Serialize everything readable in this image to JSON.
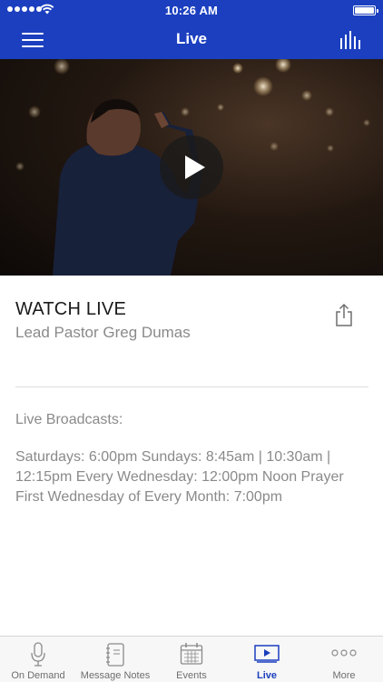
{
  "status_bar": {
    "time": "10:26 AM"
  },
  "nav": {
    "title": "Live"
  },
  "content": {
    "title": "WATCH LIVE",
    "subtitle": "Lead Pastor Greg Dumas",
    "broadcasts_heading": "Live Broadcasts:",
    "schedule_lines": [
      "Saturdays: 6:00pm  Sundays: 8:45am | 10:30am |",
      "12:15pm Every Wednesday: 12:00pm Noon Prayer",
      "First Wednesday of Every Month: 7:00pm"
    ]
  },
  "tabs": [
    {
      "label": "On Demand",
      "icon": "microphone-icon",
      "active": false
    },
    {
      "label": "Message Notes",
      "icon": "notebook-icon",
      "active": false
    },
    {
      "label": "Events",
      "icon": "calendar-icon",
      "active": false
    },
    {
      "label": "Live",
      "icon": "video-play-icon",
      "active": true
    },
    {
      "label": "More",
      "icon": "more-dots-icon",
      "active": false
    }
  ],
  "colors": {
    "brand": "#1b3fbf",
    "tab_inactive": "#6e6e6e",
    "secondary_text": "#8a8a8a"
  }
}
